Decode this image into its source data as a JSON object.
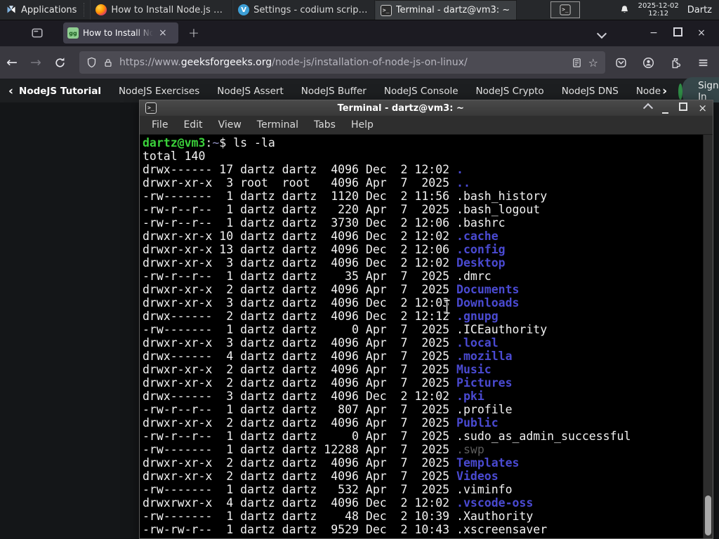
{
  "colors": {
    "gfg_green": "#2f8d46",
    "terminal_dir_blue": "#4a4ad2",
    "prompt_green": "#3bd13b",
    "panel_bg": "#26282b",
    "terminal_bg": "#000000"
  },
  "panel": {
    "applications_label": "Applications",
    "window_buttons": [
      {
        "title": "How to Install Node.js o...",
        "icon": "firefox",
        "active": false
      },
      {
        "title": "Settings - codium script...",
        "icon": "codium",
        "active": false
      },
      {
        "title": "Terminal - dartz@vm3: ~",
        "icon": "terminal",
        "active": true
      }
    ],
    "clock": {
      "date": "2025-12-02",
      "time": "12:12"
    },
    "user_label": "Dartz"
  },
  "browser": {
    "tab_title": "How to Install Node.js on",
    "tab_close": "×",
    "new_tab_label": "+",
    "window_controls": {
      "minimize": "−",
      "close": "×"
    },
    "urlbar": {
      "url_prefix": "https://www.",
      "url_domain": "geeksforgeeks.org",
      "url_path": "/node-js/installation-of-node-js-on-linux/",
      "bookmark_star": "☆"
    }
  },
  "site_nav": {
    "back_chevron": "‹",
    "more_chevron": "›",
    "items": [
      "NodeJS Tutorial",
      "NodeJS Exercises",
      "NodeJS Assert",
      "NodeJS Buffer",
      "NodeJS Console",
      "NodeJS Crypto",
      "NodeJS DNS",
      "Node"
    ],
    "sign_in_label": "Sign In"
  },
  "terminal": {
    "title": "Terminal - dartz@vm3: ~",
    "menu": [
      "File",
      "Edit",
      "View",
      "Terminal",
      "Tabs",
      "Help"
    ],
    "close_glyph": "×",
    "prompt": {
      "userhost": "dartz@vm3",
      "separator": ":",
      "cwd": "~",
      "suffix": "$",
      "command": "ls -la"
    },
    "total_line": "total 140",
    "listing": [
      {
        "perms": "drwx------",
        "links": 17,
        "owner": "dartz",
        "group": "dartz",
        "size": 4096,
        "month": "Dec",
        "day": 2,
        "time": "12:02",
        "name": ".",
        "kind": "dir"
      },
      {
        "perms": "drwxr-xr-x",
        "links": 3,
        "owner": "root",
        "group": "root",
        "size": 4096,
        "month": "Apr",
        "day": 7,
        "time": "2025",
        "name": "..",
        "kind": "dir"
      },
      {
        "perms": "-rw-------",
        "links": 1,
        "owner": "dartz",
        "group": "dartz",
        "size": 1120,
        "month": "Dec",
        "day": 2,
        "time": "11:56",
        "name": ".bash_history",
        "kind": "file"
      },
      {
        "perms": "-rw-r--r--",
        "links": 1,
        "owner": "dartz",
        "group": "dartz",
        "size": 220,
        "month": "Apr",
        "day": 7,
        "time": "2025",
        "name": ".bash_logout",
        "kind": "file"
      },
      {
        "perms": "-rw-r--r--",
        "links": 1,
        "owner": "dartz",
        "group": "dartz",
        "size": 3730,
        "month": "Dec",
        "day": 2,
        "time": "12:06",
        "name": ".bashrc",
        "kind": "file"
      },
      {
        "perms": "drwxr-xr-x",
        "links": 10,
        "owner": "dartz",
        "group": "dartz",
        "size": 4096,
        "month": "Dec",
        "day": 2,
        "time": "12:02",
        "name": ".cache",
        "kind": "dir"
      },
      {
        "perms": "drwxr-xr-x",
        "links": 13,
        "owner": "dartz",
        "group": "dartz",
        "size": 4096,
        "month": "Dec",
        "day": 2,
        "time": "12:06",
        "name": ".config",
        "kind": "dir"
      },
      {
        "perms": "drwxr-xr-x",
        "links": 3,
        "owner": "dartz",
        "group": "dartz",
        "size": 4096,
        "month": "Dec",
        "day": 2,
        "time": "12:02",
        "name": "Desktop",
        "kind": "dir"
      },
      {
        "perms": "-rw-r--r--",
        "links": 1,
        "owner": "dartz",
        "group": "dartz",
        "size": 35,
        "month": "Apr",
        "day": 7,
        "time": "2025",
        "name": ".dmrc",
        "kind": "file"
      },
      {
        "perms": "drwxr-xr-x",
        "links": 2,
        "owner": "dartz",
        "group": "dartz",
        "size": 4096,
        "month": "Apr",
        "day": 7,
        "time": "2025",
        "name": "Documents",
        "kind": "dir"
      },
      {
        "perms": "drwxr-xr-x",
        "links": 3,
        "owner": "dartz",
        "group": "dartz",
        "size": 4096,
        "month": "Dec",
        "day": 2,
        "time": "12:03",
        "name": "Downloads",
        "kind": "dir"
      },
      {
        "perms": "drwx------",
        "links": 2,
        "owner": "dartz",
        "group": "dartz",
        "size": 4096,
        "month": "Dec",
        "day": 2,
        "time": "12:12",
        "name": ".gnupg",
        "kind": "dir"
      },
      {
        "perms": "-rw-------",
        "links": 1,
        "owner": "dartz",
        "group": "dartz",
        "size": 0,
        "month": "Apr",
        "day": 7,
        "time": "2025",
        "name": ".ICEauthority",
        "kind": "file"
      },
      {
        "perms": "drwxr-xr-x",
        "links": 3,
        "owner": "dartz",
        "group": "dartz",
        "size": 4096,
        "month": "Apr",
        "day": 7,
        "time": "2025",
        "name": ".local",
        "kind": "dir"
      },
      {
        "perms": "drwx------",
        "links": 4,
        "owner": "dartz",
        "group": "dartz",
        "size": 4096,
        "month": "Apr",
        "day": 7,
        "time": "2025",
        "name": ".mozilla",
        "kind": "dir"
      },
      {
        "perms": "drwxr-xr-x",
        "links": 2,
        "owner": "dartz",
        "group": "dartz",
        "size": 4096,
        "month": "Apr",
        "day": 7,
        "time": "2025",
        "name": "Music",
        "kind": "dir"
      },
      {
        "perms": "drwxr-xr-x",
        "links": 2,
        "owner": "dartz",
        "group": "dartz",
        "size": 4096,
        "month": "Apr",
        "day": 7,
        "time": "2025",
        "name": "Pictures",
        "kind": "dir"
      },
      {
        "perms": "drwx------",
        "links": 3,
        "owner": "dartz",
        "group": "dartz",
        "size": 4096,
        "month": "Dec",
        "day": 2,
        "time": "12:02",
        "name": ".pki",
        "kind": "dir"
      },
      {
        "perms": "-rw-r--r--",
        "links": 1,
        "owner": "dartz",
        "group": "dartz",
        "size": 807,
        "month": "Apr",
        "day": 7,
        "time": "2025",
        "name": ".profile",
        "kind": "file"
      },
      {
        "perms": "drwxr-xr-x",
        "links": 2,
        "owner": "dartz",
        "group": "dartz",
        "size": 4096,
        "month": "Apr",
        "day": 7,
        "time": "2025",
        "name": "Public",
        "kind": "dir"
      },
      {
        "perms": "-rw-r--r--",
        "links": 1,
        "owner": "dartz",
        "group": "dartz",
        "size": 0,
        "month": "Apr",
        "day": 7,
        "time": "2025",
        "name": ".sudo_as_admin_successful",
        "kind": "file"
      },
      {
        "perms": "-rw-------",
        "links": 1,
        "owner": "dartz",
        "group": "dartz",
        "size": 12288,
        "month": "Apr",
        "day": 7,
        "time": "2025",
        "name": ".swp",
        "kind": "dim"
      },
      {
        "perms": "drwxr-xr-x",
        "links": 2,
        "owner": "dartz",
        "group": "dartz",
        "size": 4096,
        "month": "Apr",
        "day": 7,
        "time": "2025",
        "name": "Templates",
        "kind": "dir"
      },
      {
        "perms": "drwxr-xr-x",
        "links": 2,
        "owner": "dartz",
        "group": "dartz",
        "size": 4096,
        "month": "Apr",
        "day": 7,
        "time": "2025",
        "name": "Videos",
        "kind": "dir"
      },
      {
        "perms": "-rw-------",
        "links": 1,
        "owner": "dartz",
        "group": "dartz",
        "size": 532,
        "month": "Apr",
        "day": 7,
        "time": "2025",
        "name": ".viminfo",
        "kind": "file"
      },
      {
        "perms": "drwxrwxr-x",
        "links": 4,
        "owner": "dartz",
        "group": "dartz",
        "size": 4096,
        "month": "Dec",
        "day": 2,
        "time": "12:02",
        "name": ".vscode-oss",
        "kind": "dir"
      },
      {
        "perms": "-rw-------",
        "links": 1,
        "owner": "dartz",
        "group": "dartz",
        "size": 48,
        "month": "Dec",
        "day": 2,
        "time": "10:39",
        "name": ".Xauthority",
        "kind": "file"
      },
      {
        "perms": "-rw-rw-r--",
        "links": 1,
        "owner": "dartz",
        "group": "dartz",
        "size": 9529,
        "month": "Dec",
        "day": 2,
        "time": "10:43",
        "name": ".xscreensaver",
        "kind": "file"
      }
    ]
  }
}
